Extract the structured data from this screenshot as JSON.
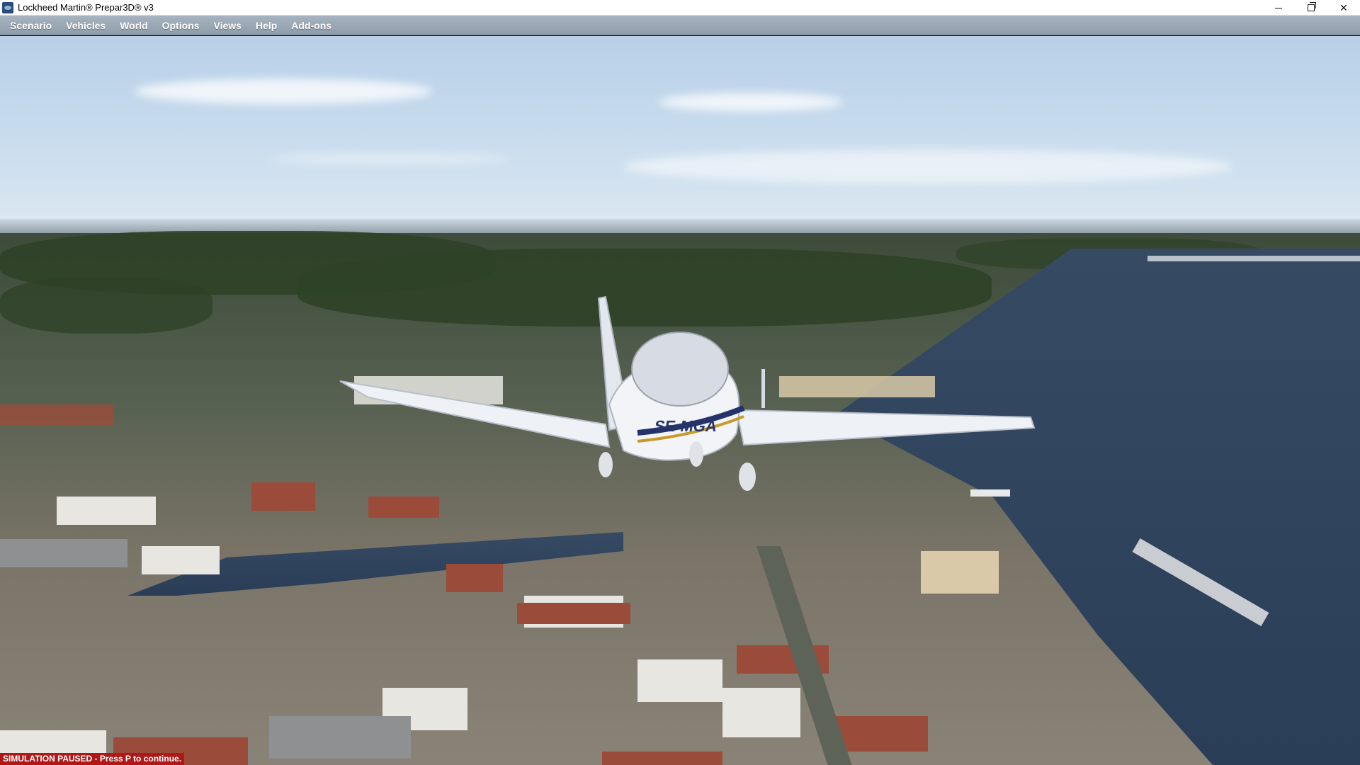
{
  "window": {
    "title": "Lockheed Martin® Prepar3D® v3",
    "icon": "prepar3d-app-icon",
    "controls": {
      "minimize_icon": "minimize-icon",
      "maximize_icon": "restore-icon",
      "close_icon": "close-icon",
      "close_glyph": "✕"
    }
  },
  "menubar": {
    "items": [
      {
        "label": "Scenario"
      },
      {
        "label": "Vehicles"
      },
      {
        "label": "World"
      },
      {
        "label": "Options"
      },
      {
        "label": "Views"
      },
      {
        "label": "Help"
      },
      {
        "label": "Add-ons"
      }
    ]
  },
  "scene": {
    "aircraft_registration": "SE-MGA"
  },
  "status": {
    "message": "SIMULATION PAUSED - Press P to continue."
  },
  "colors": {
    "menubar": "#9aa7b4",
    "status_bg": "#b01818",
    "sky": "#c9dcee",
    "water": "#2f4460"
  }
}
